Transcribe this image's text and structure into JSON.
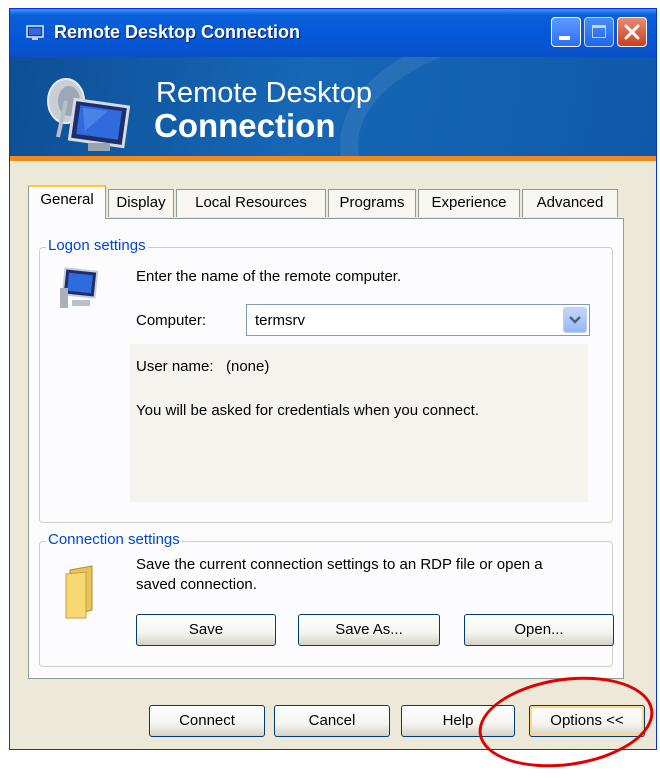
{
  "window": {
    "title": "Remote Desktop Connection"
  },
  "banner": {
    "line1": "Remote Desktop",
    "line2": "Connection",
    "accent_color": "#f08a1c"
  },
  "tabs": [
    {
      "label": "General",
      "active": true
    },
    {
      "label": "Display"
    },
    {
      "label": "Local Resources"
    },
    {
      "label": "Programs"
    },
    {
      "label": "Experience"
    },
    {
      "label": "Advanced"
    }
  ],
  "logon": {
    "group_title": "Logon settings",
    "instruction": "Enter the name of the remote computer.",
    "computer_label": "Computer:",
    "computer_value": "termsrv",
    "username_label": "User name:",
    "username_value": "(none)",
    "credentials_note": "You will be asked for credentials when you connect."
  },
  "connection_settings": {
    "group_title": "Connection settings",
    "description_line1": "Save the current connection settings to an RDP file or open a",
    "description_line2": "saved connection.",
    "save_label": "Save",
    "save_as_label": "Save As...",
    "open_label": "Open..."
  },
  "footer": {
    "connect_label": "Connect",
    "cancel_label": "Cancel",
    "help_label": "Help",
    "options_label": "Options <<"
  },
  "highlight": {
    "color": "#e00000",
    "target": "options-button"
  }
}
